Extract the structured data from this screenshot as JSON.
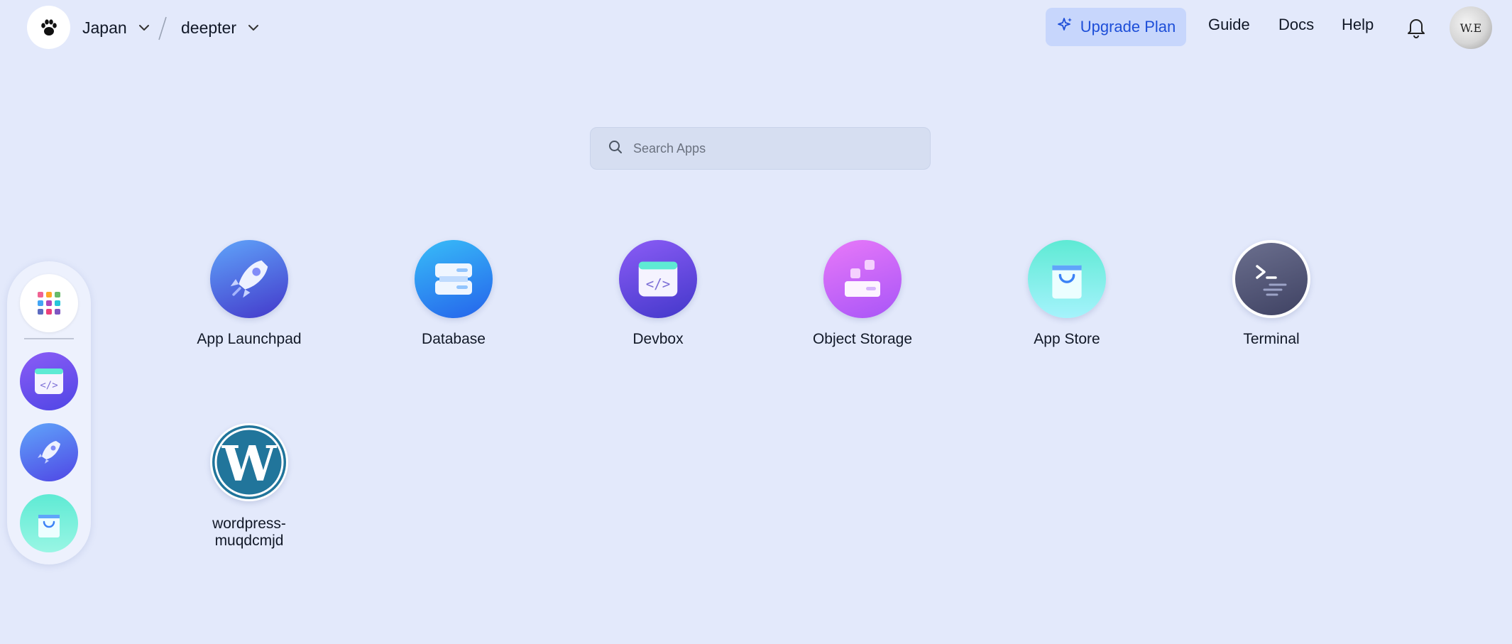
{
  "header": {
    "logo_icon": "paw-icon",
    "workspace": "Japan",
    "project": "deepter",
    "upgrade_label": "Upgrade Plan",
    "nav": [
      "Guide",
      "Docs",
      "Help"
    ],
    "avatar_text": "W.E",
    "accent_color": "#1d4ed8"
  },
  "search": {
    "placeholder": "Search Apps",
    "value": ""
  },
  "dock": {
    "items": [
      "grid-icon",
      "devbox-icon",
      "rocket-icon",
      "app-store-icon"
    ]
  },
  "apps": [
    {
      "label": "App Launchpad",
      "icon": "rocket-icon"
    },
    {
      "label": "Database",
      "icon": "database-icon"
    },
    {
      "label": "Devbox",
      "icon": "devbox-icon"
    },
    {
      "label": "Object Storage",
      "icon": "object-storage-icon"
    },
    {
      "label": "App Store",
      "icon": "shopping-bag-icon"
    },
    {
      "label": "Terminal",
      "icon": "terminal-icon"
    },
    {
      "label": "wordpress-\nmuqdcmjd",
      "icon": "wordpress-icon"
    }
  ]
}
